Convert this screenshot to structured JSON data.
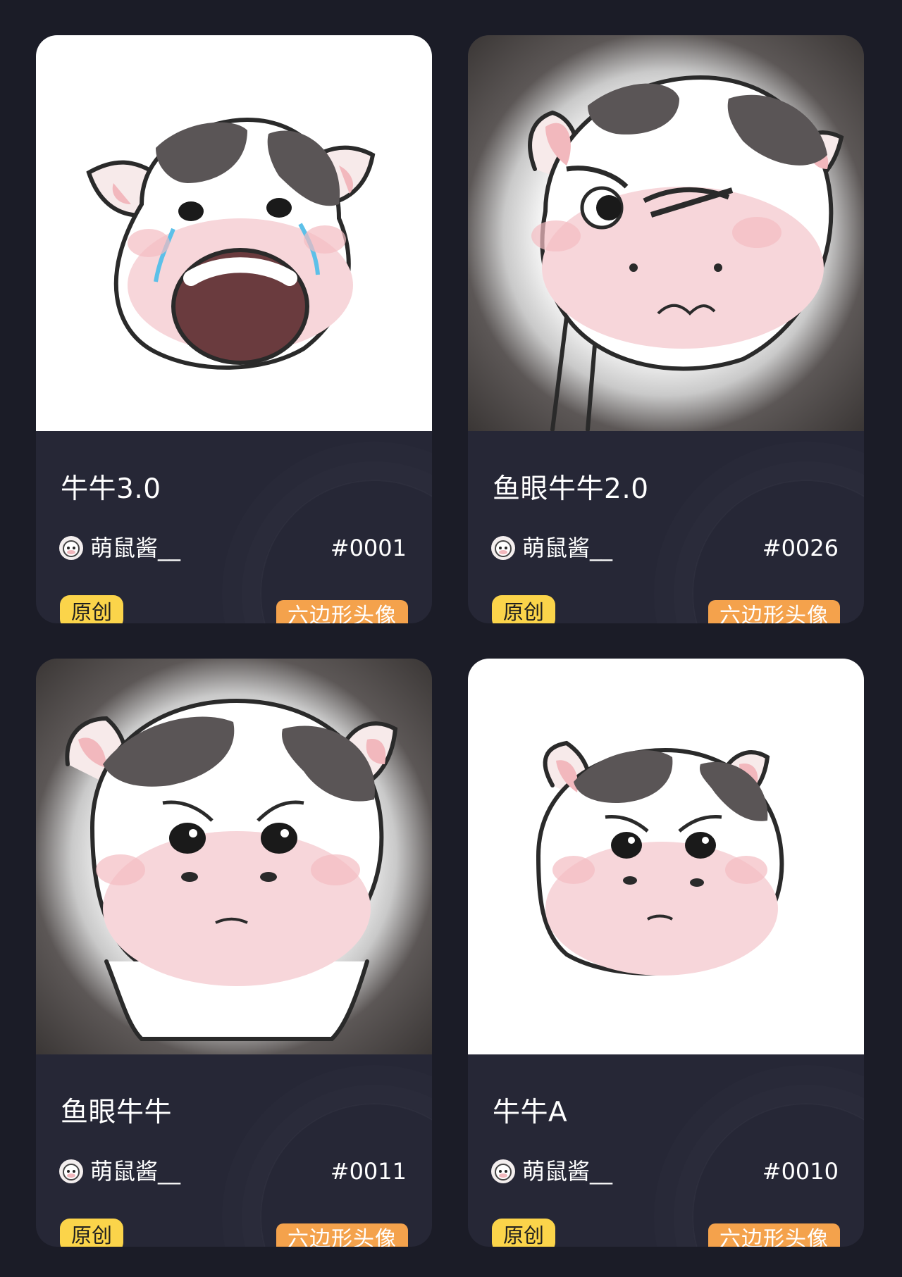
{
  "cards": [
    {
      "title": "牛牛3.0",
      "author": "萌鼠酱__",
      "number": "#0001",
      "badge": "原创",
      "tag": "六边形头像",
      "art": "crying-cow-face",
      "background": "white"
    },
    {
      "title": "鱼眼牛牛2.0",
      "author": "萌鼠酱__",
      "number": "#0026",
      "badge": "原创",
      "tag": "六边形头像",
      "art": "winking-cow-fisheye",
      "background": "fisheye"
    },
    {
      "title": "鱼眼牛牛",
      "author": "萌鼠酱__",
      "number": "#0011",
      "badge": "原创",
      "tag": "六边形头像",
      "art": "serious-cow-fisheye",
      "background": "fisheye"
    },
    {
      "title": "牛牛A",
      "author": "萌鼠酱__",
      "number": "#0010",
      "badge": "原创",
      "tag": "六边形头像",
      "art": "serious-cow-face",
      "background": "white"
    }
  ],
  "colors": {
    "page_background": "#1b1c27",
    "card_background": "#262736",
    "badge_original": "#fbd44a",
    "tag_hexagon": "#f4a24c"
  }
}
